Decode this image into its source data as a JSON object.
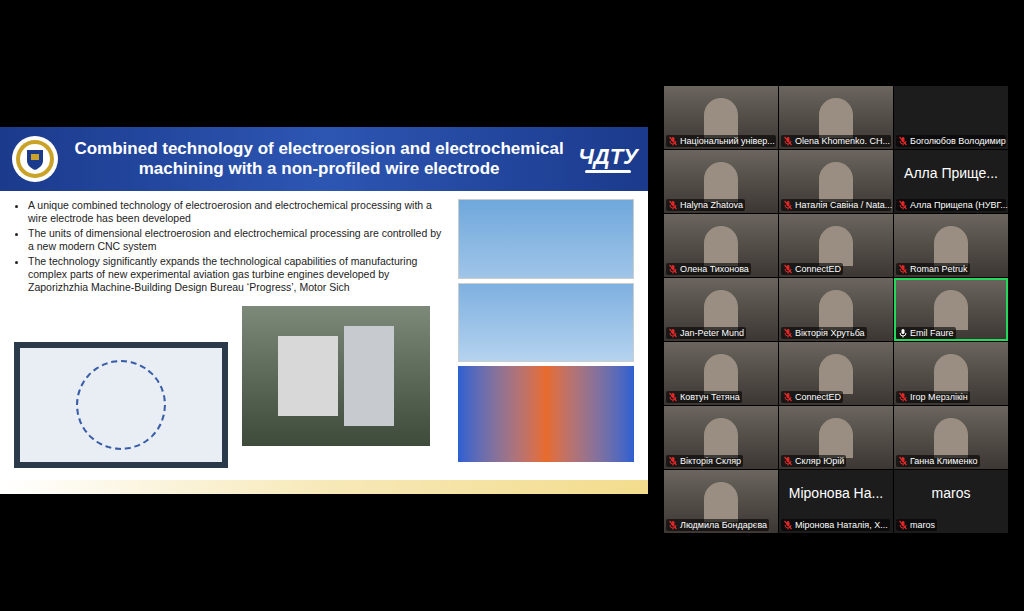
{
  "slide": {
    "title": "Combined technology of electroerosion and electrochemical machining with a non-profiled wire electrode",
    "right_logo": "ЧДТУ",
    "bullets": [
      "A unique combined technology of electroerosion and electrochemical processing with a wire electrode has been developed",
      "The units of dimensional electroerosion and electrochemical processing are controlled by a new modern CNC system",
      "The technology significantly expands the technological capabilities of manufacturing complex parts of new experimental aviation gas turbine engines developed by Zaporizhzhia Machine-Building Design Bureau ‘Progress’, Motor Sich"
    ]
  },
  "participants": [
    {
      "label": "Національний універ...",
      "kind": "video",
      "big_name": "",
      "muted": true,
      "active_speaker": false
    },
    {
      "label": "Olena Khomenko. CH...",
      "kind": "video",
      "big_name": "",
      "muted": true,
      "active_speaker": false
    },
    {
      "label": "Боголюбов Володимир",
      "kind": "blank",
      "big_name": "",
      "muted": true,
      "active_speaker": false
    },
    {
      "label": "Halyna Zhatova",
      "kind": "video",
      "big_name": "",
      "muted": true,
      "active_speaker": false
    },
    {
      "label": "Наталія Савіна / Nata...",
      "kind": "video",
      "big_name": "",
      "muted": true,
      "active_speaker": false
    },
    {
      "label": "Алла Прищепа (НУВГ...",
      "kind": "avatar",
      "big_name": "Алла Прище...",
      "muted": true,
      "active_speaker": false
    },
    {
      "label": "Олена Тихонова",
      "kind": "video",
      "big_name": "",
      "muted": true,
      "active_speaker": false
    },
    {
      "label": "ConnectED",
      "kind": "video",
      "big_name": "",
      "muted": true,
      "active_speaker": false
    },
    {
      "label": "Roman Petruk",
      "kind": "video",
      "big_name": "",
      "muted": true,
      "active_speaker": false
    },
    {
      "label": "Jan-Peter Mund",
      "kind": "video",
      "big_name": "",
      "muted": true,
      "active_speaker": false
    },
    {
      "label": "Вікторія Хрутьба",
      "kind": "video",
      "big_name": "",
      "muted": true,
      "active_speaker": false
    },
    {
      "label": "Emil Faure",
      "kind": "video",
      "big_name": "",
      "muted": false,
      "active_speaker": true
    },
    {
      "label": "Ковтун Тетяна",
      "kind": "video",
      "big_name": "",
      "muted": true,
      "active_speaker": false
    },
    {
      "label": "ConnectED",
      "kind": "video",
      "big_name": "",
      "muted": true,
      "active_speaker": false
    },
    {
      "label": "Ігор Мерзлікін",
      "kind": "video",
      "big_name": "",
      "muted": true,
      "active_speaker": false
    },
    {
      "label": "Вікторія Скляр",
      "kind": "video",
      "big_name": "",
      "muted": true,
      "active_speaker": false
    },
    {
      "label": "Скляр Юрій",
      "kind": "video",
      "big_name": "",
      "muted": true,
      "active_speaker": false
    },
    {
      "label": "Ганна Клименко",
      "kind": "video",
      "big_name": "",
      "muted": true,
      "active_speaker": false
    },
    {
      "label": "Людмила Бондарєва",
      "kind": "video",
      "big_name": "",
      "muted": true,
      "active_speaker": false
    },
    {
      "label": "Міронова Наталія, Х...",
      "kind": "avatar",
      "big_name": "Міронова На...",
      "muted": true,
      "active_speaker": false
    },
    {
      "label": "maros",
      "kind": "avatar",
      "big_name": "maros",
      "muted": true,
      "active_speaker": false
    }
  ]
}
